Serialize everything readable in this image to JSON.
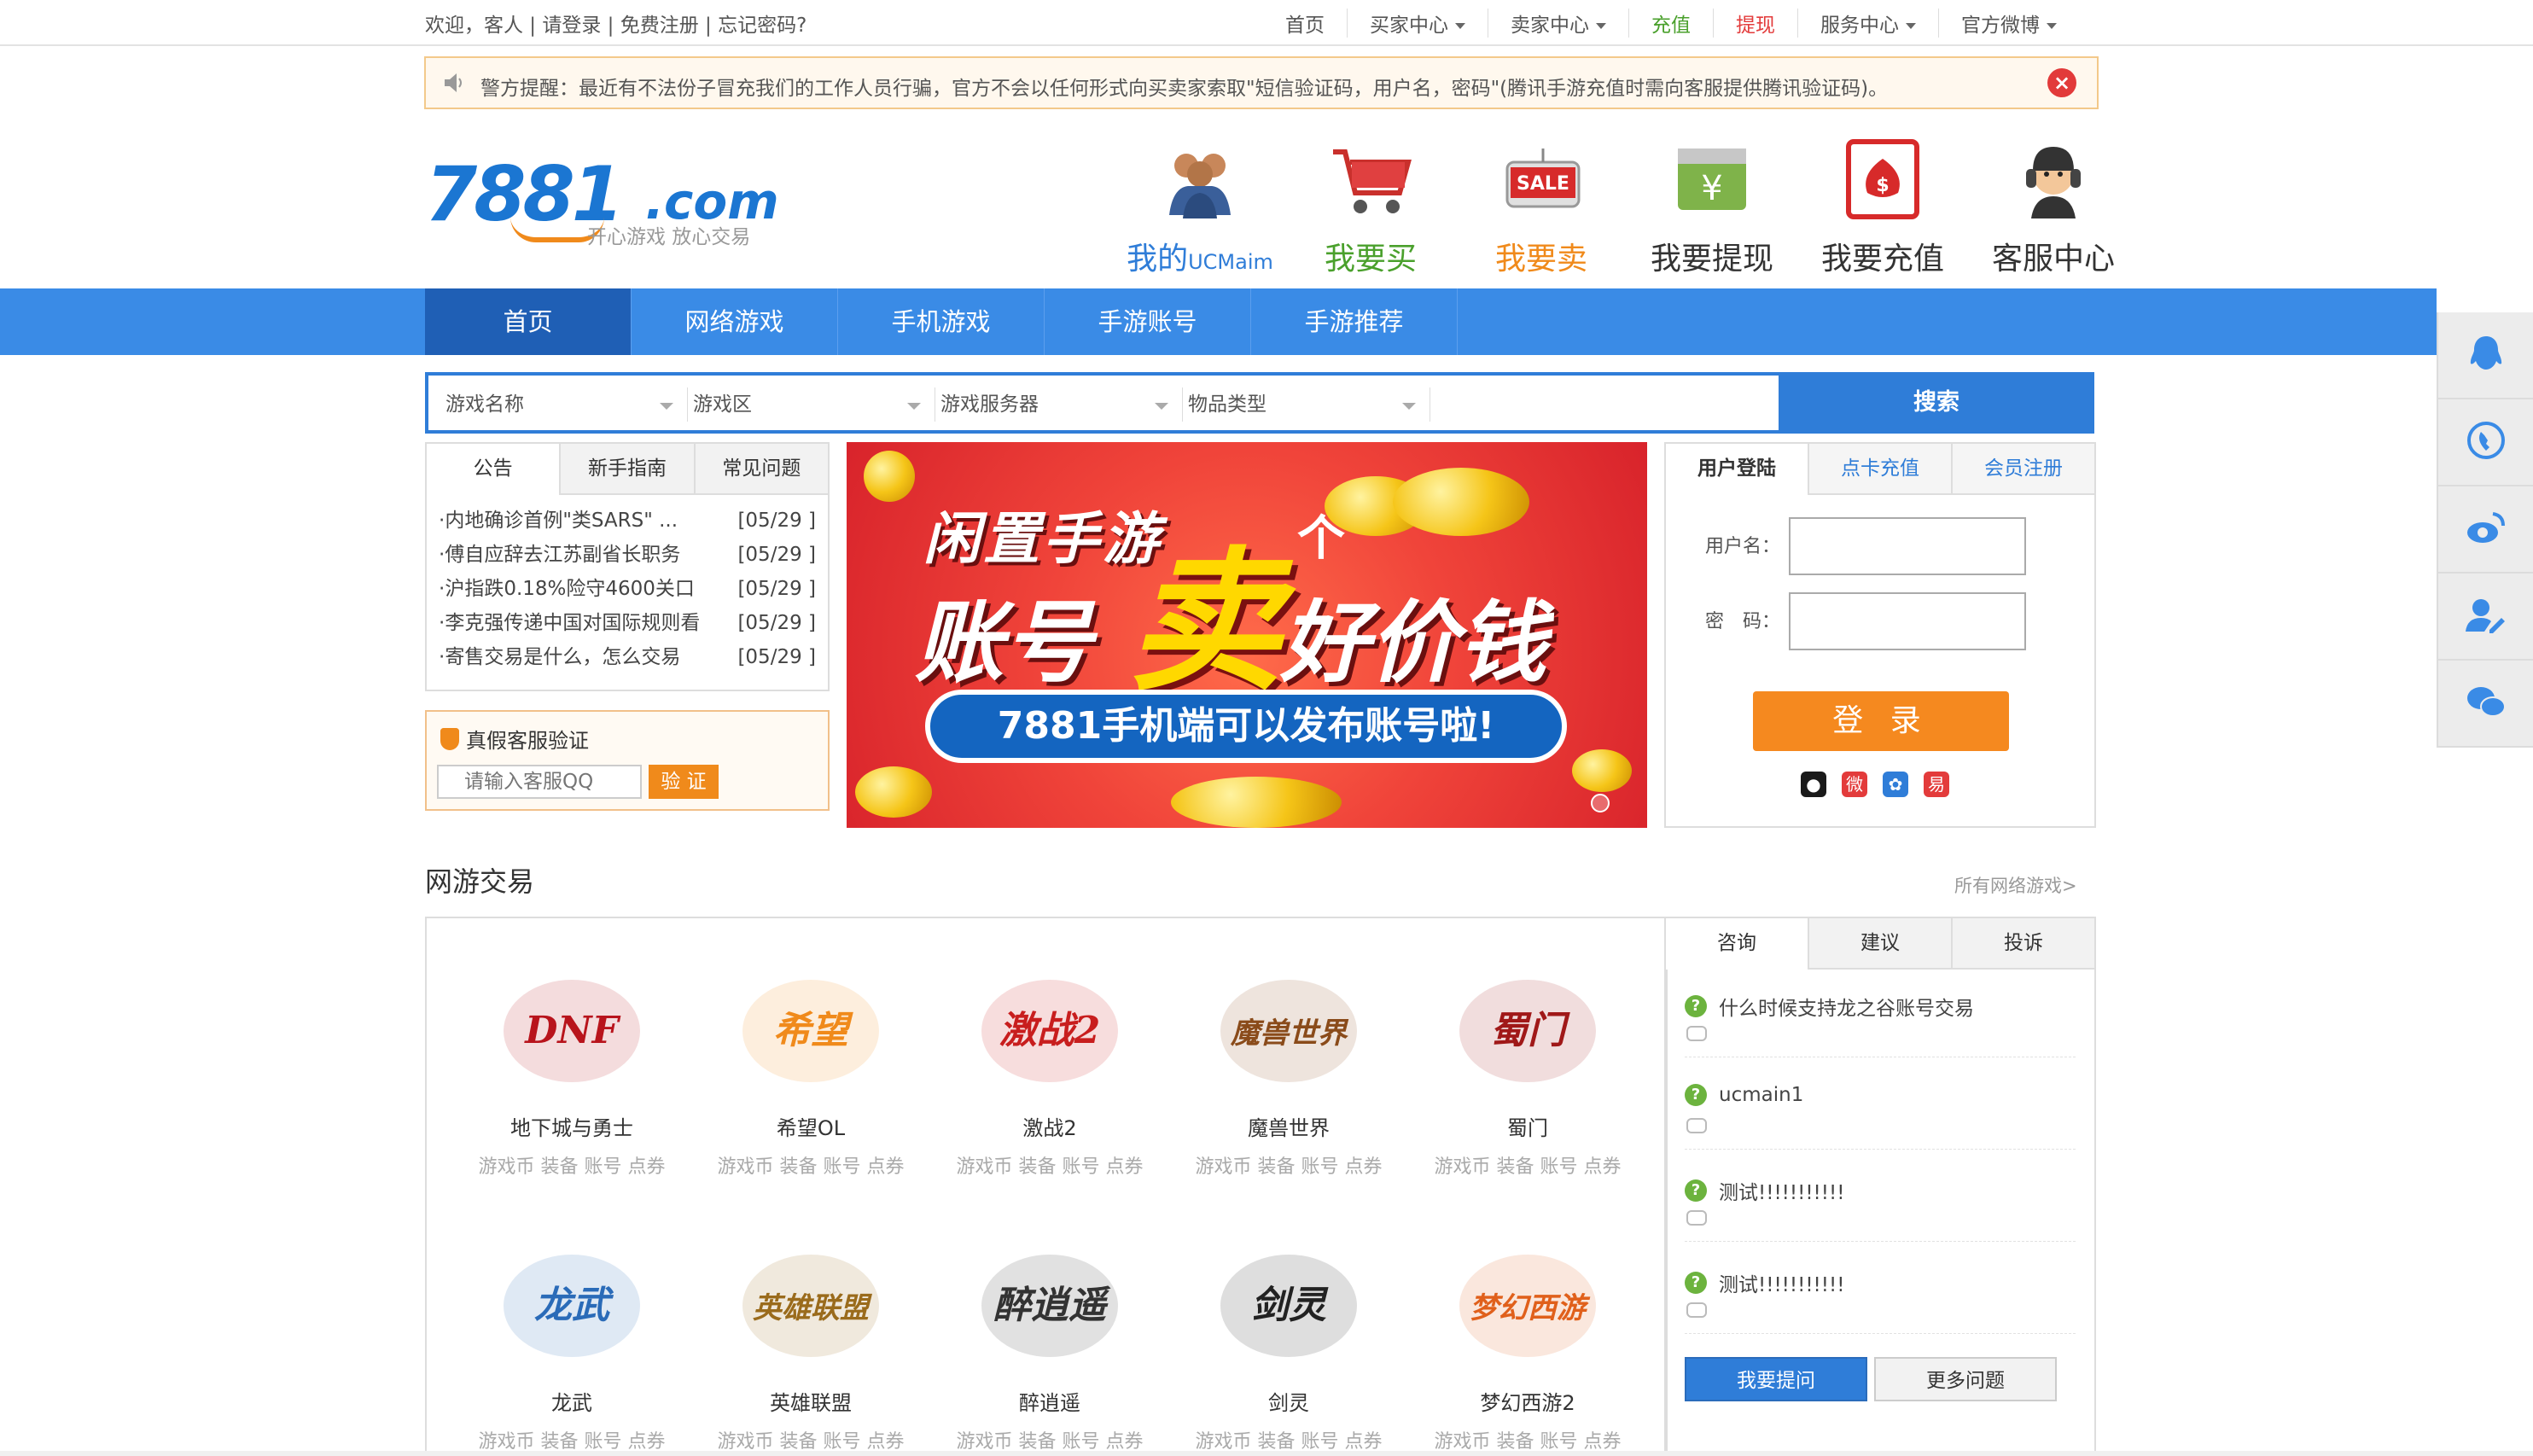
{
  "topbar": {
    "welcome": "欢迎，客人 | 请登录 | 免费注册 | 忘记密码?",
    "nav": [
      {
        "label": "首页",
        "caret": false,
        "color": "#555555"
      },
      {
        "label": "买家中心",
        "caret": true,
        "color": "#555555"
      },
      {
        "label": "卖家中心",
        "caret": true,
        "color": "#555555"
      },
      {
        "label": "充值",
        "caret": false,
        "color": "#4aa02c"
      },
      {
        "label": "提现",
        "caret": false,
        "color": "#e33b3b"
      },
      {
        "label": "服务中心",
        "caret": true,
        "color": "#555555"
      },
      {
        "label": "官方微博",
        "caret": true,
        "color": "#555555"
      }
    ]
  },
  "warning": {
    "text": "警方提醒：最近有不法份子冒充我们的工作人员行骗，官方不会以任何形式向买卖家索取\"短信验证码，用户名，密码\"(腾讯手游充值时需向客服提供腾讯验证码)。",
    "close": "×"
  },
  "logo": {
    "number": "7881",
    "domain": ".com",
    "slogan": "开心游戏 放心交易"
  },
  "quicklinks": [
    {
      "label": "我的",
      "sub": "UCMaim",
      "icon": "users-icon",
      "color": "#2f7dd8"
    },
    {
      "label": "我要买",
      "sub": "",
      "icon": "cart-icon",
      "color": "#4aa02c"
    },
    {
      "label": "我要卖",
      "sub": "",
      "icon": "sale-tag-icon",
      "color": "#f08a1b"
    },
    {
      "label": "我要提现",
      "sub": "",
      "icon": "withdraw-icon",
      "color": "#333333"
    },
    {
      "label": "我要充值",
      "sub": "",
      "icon": "moneybag-icon",
      "color": "#333333"
    },
    {
      "label": "客服中心",
      "sub": "",
      "icon": "headset-agent-icon",
      "color": "#333333"
    }
  ],
  "mainnav": [
    "首页",
    "网络游戏",
    "手机游戏",
    "手游账号",
    "手游推荐"
  ],
  "search": {
    "fields": [
      "游戏名称",
      "游戏区",
      "游戏服务器",
      "物品类型"
    ],
    "button": "搜索"
  },
  "notice": {
    "tabs": [
      "公告",
      "新手指南",
      "常见问题"
    ],
    "items": [
      {
        "title": "内地确诊首例\"类SARS\" ...",
        "date": "[05/29 ]"
      },
      {
        "title": "傅自应辞去江苏副省长职务",
        "date": "[05/29 ]"
      },
      {
        "title": "沪指跌0.18%险守4600关口",
        "date": "[05/29 ]"
      },
      {
        "title": "李克强传递中国对国际规则看",
        "date": "[05/29 ]"
      },
      {
        "title": "寄售交易是什么，怎么交易",
        "date": "[05/29 ]"
      }
    ]
  },
  "verify": {
    "title": "真假客服验证",
    "placeholder": "请输入客服QQ",
    "button": "验 证"
  },
  "banner": {
    "line1": "闲置手游",
    "line2": "账号",
    "sell": "卖",
    "ge": "个",
    "line3": "好价钱",
    "pill": "7881手机端可以发布账号啦!"
  },
  "login": {
    "tabs": [
      "用户登陆",
      "点卡充值",
      "会员注册"
    ],
    "username_label": "用户名：",
    "password_label": "密　码：",
    "button": "登 录",
    "social": [
      {
        "icon": "qq-icon",
        "color": "#1a1a1a"
      },
      {
        "icon": "weibo-icon",
        "color": "#e33b3b"
      },
      {
        "icon": "baidu-icon",
        "color": "#2f7dd8"
      },
      {
        "icon": "netease-icon",
        "color": "#e33b3b"
      }
    ]
  },
  "games_section": {
    "title": "网游交易",
    "more": "所有网络游戏>",
    "tags": "游戏币 装备 账号 点券"
  },
  "games": [
    {
      "name": "地下城与勇士",
      "logo": "DNF",
      "color": "#b8141c"
    },
    {
      "name": "希望OL",
      "logo": "希望",
      "color": "#f08a1b"
    },
    {
      "name": "激战2",
      "logo": "激战2",
      "color": "#c81e1e"
    },
    {
      "name": "魔兽世界",
      "logo": "魔兽世界",
      "color": "#8a4b1a"
    },
    {
      "name": "蜀门",
      "logo": "蜀门",
      "color": "#a01818"
    },
    {
      "name": "龙武",
      "logo": "龙武",
      "color": "#2a6bb8"
    },
    {
      "name": "英雄联盟",
      "logo": "英雄联盟",
      "color": "#9a6b1c"
    },
    {
      "name": "醉逍遥",
      "logo": "醉逍遥",
      "color": "#333333"
    },
    {
      "name": "剑灵",
      "logo": "剑灵",
      "color": "#222222"
    },
    {
      "name": "梦幻西游2",
      "logo": "梦幻西游",
      "color": "#e0601b"
    }
  ],
  "qa": {
    "tabs": [
      "咨询",
      "建议",
      "投诉"
    ],
    "items": [
      "什么时候支持龙之谷账号交易",
      "ucmain1",
      "测试!!!!!!!!!!!",
      "测试!!!!!!!!!!!"
    ],
    "ask": "我要提问",
    "more": "更多问题"
  },
  "rightbar": [
    "qq-icon",
    "phone-icon",
    "weibo-icon",
    "user-edit-icon",
    "wechat-icon"
  ]
}
